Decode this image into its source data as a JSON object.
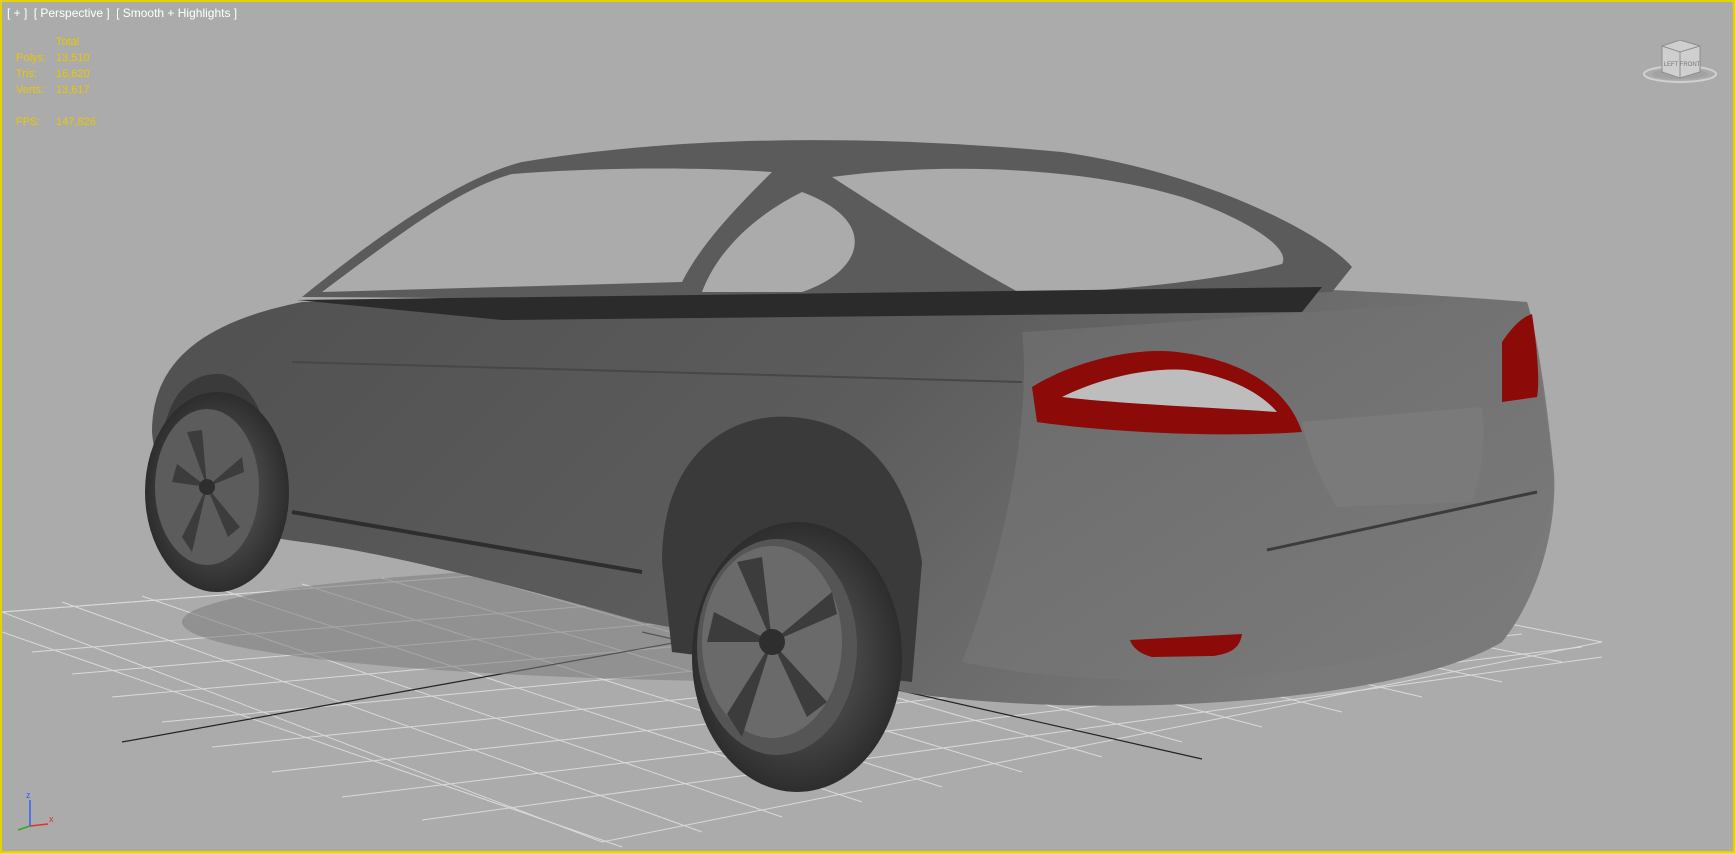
{
  "viewport": {
    "labels": [
      "[ + ]",
      "[ Perspective ]",
      "[ Smooth + Highlights ]"
    ],
    "border_color": "#e6d200",
    "background": "#ababab"
  },
  "stats": {
    "header": "Total",
    "polys_label": "Polys:",
    "polys_value": "13,510",
    "tris_label": "Tris:",
    "tris_value": "16,620",
    "verts_label": "Verts:",
    "verts_value": "13,617",
    "fps_label": "FPS:",
    "fps_value": "147,826",
    "text_color": "#e8c800"
  },
  "viewcube": {
    "face_left": "LEFT",
    "face_front": "FRONT",
    "icon": "viewcube-icon"
  },
  "axis": {
    "x": "x",
    "z": "z",
    "icon": "axis-tripod-icon"
  },
  "model": {
    "body_color": "#5a5a5a",
    "taillight_color": "#8c0a08"
  }
}
